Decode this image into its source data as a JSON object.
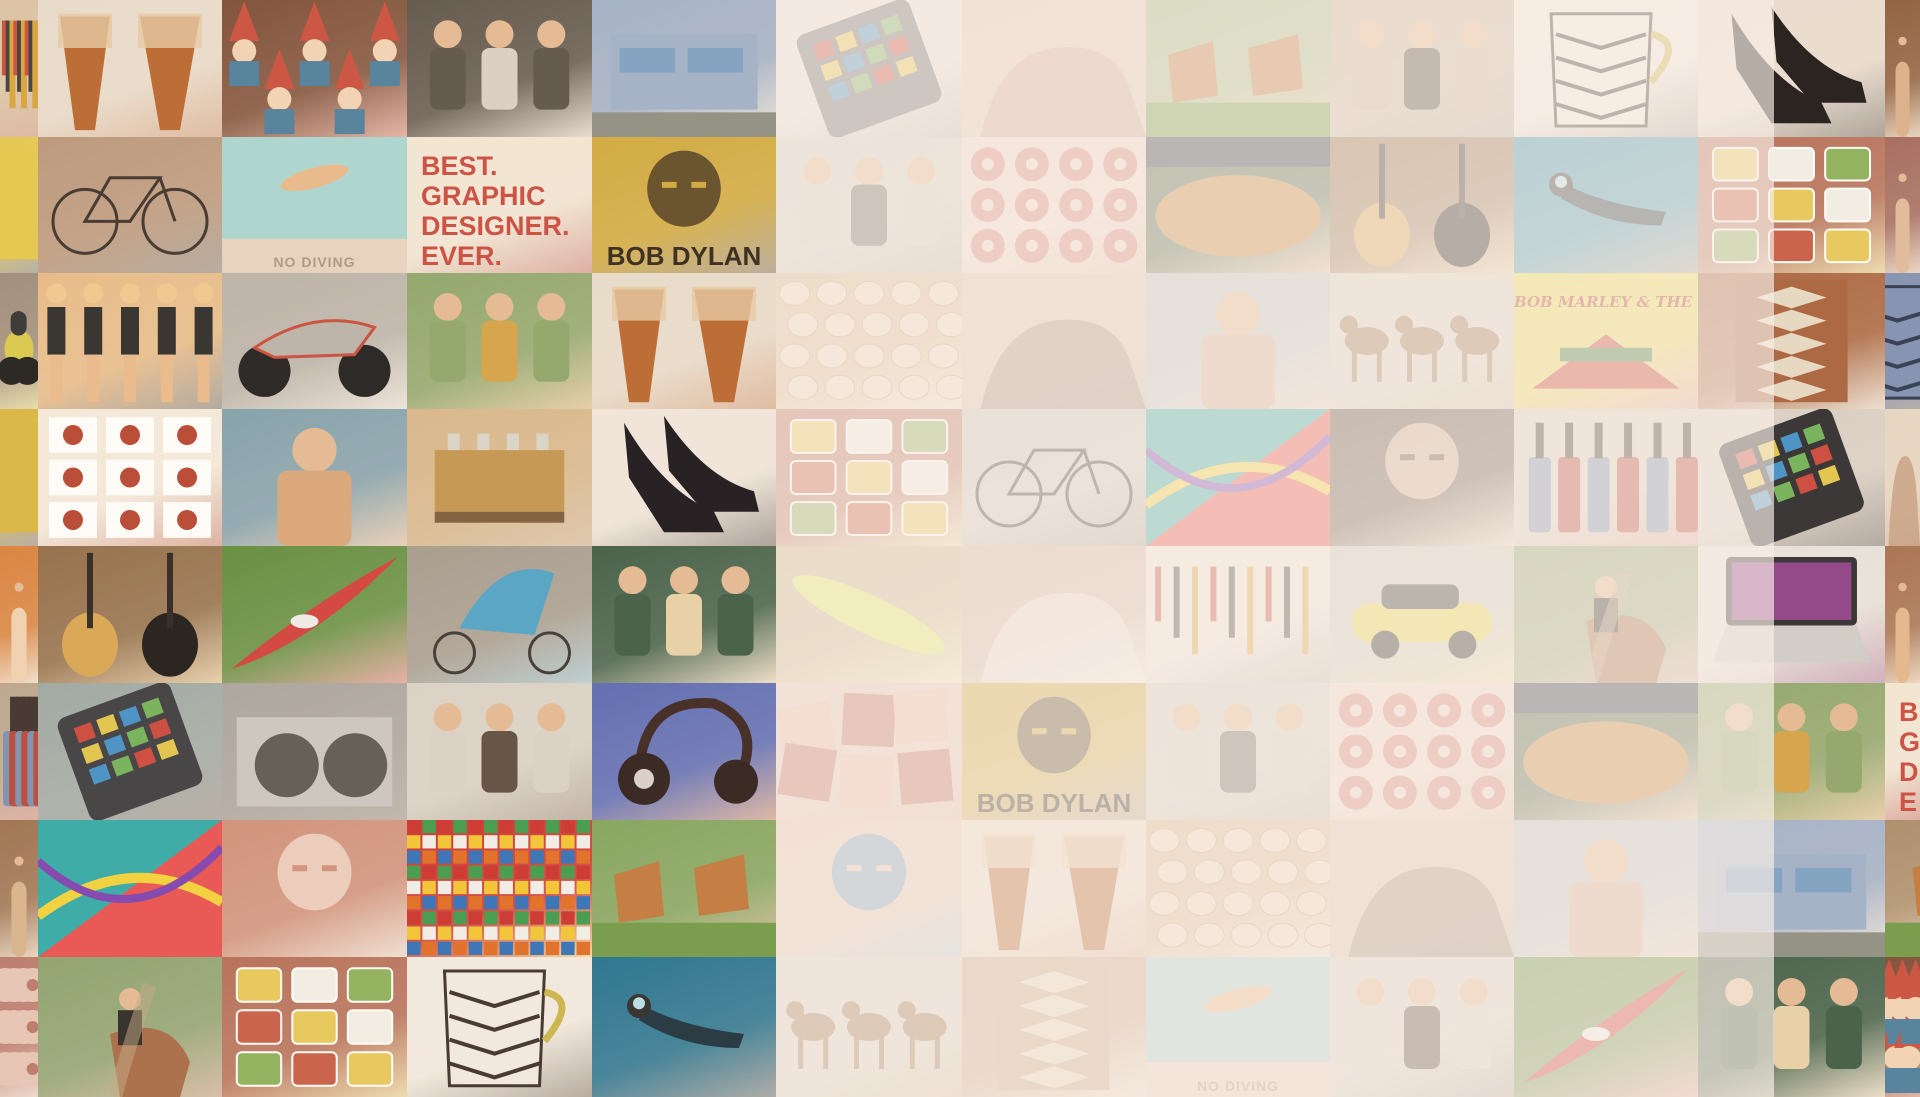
{
  "colors": {
    "veil": "#f8f0ec",
    "background": "#efe6dc"
  },
  "tiles": [
    {
      "name": "tool-rack-photo",
      "icon": "tools",
      "colors": [
        "#d9c3a3",
        "#b55a3c"
      ]
    },
    {
      "name": "djembe-drums-photo",
      "icon": "drums",
      "colors": [
        "#e8dccd",
        "#b8652e"
      ]
    },
    {
      "name": "garden-gnomes-photo",
      "icon": "gnomes",
      "colors": [
        "#7a4a34",
        "#c84d3d"
      ]
    },
    {
      "name": "guitar-band-photo",
      "icon": "people",
      "colors": [
        "#5a5148",
        "#d8d0c6"
      ]
    },
    {
      "name": "modern-house-photo",
      "icon": "house",
      "colors": [
        "#9fb0c9",
        "#e7e4e0"
      ]
    },
    {
      "name": "calculator-photo",
      "icon": "phone",
      "colors": [
        "#e9e2dc",
        "#6a6a70"
      ]
    },
    {
      "name": "hand-closeup-photo",
      "icon": "hand",
      "colors": [
        "#e3c4b8",
        "#c79a8b"
      ]
    },
    {
      "name": "lawn-chairs-photo",
      "icon": "chairs",
      "colors": [
        "#9eb77f",
        "#c0773c"
      ]
    },
    {
      "name": "street-group-photo",
      "icon": "people",
      "colors": [
        "#c7b39e",
        "#4d4136"
      ]
    },
    {
      "name": "patterned-mug-photo",
      "icon": "mug",
      "colors": [
        "#f1ebe3",
        "#3a2e2b"
      ]
    },
    {
      "name": "black-heels-photo",
      "icon": "heels",
      "colors": [
        "#e8ddd1",
        "#1a1516"
      ]
    },
    {
      "name": "portrait-photo",
      "icon": "person",
      "colors": [
        "#8a5b3b",
        "#d9b08a"
      ]
    },
    {
      "name": "yellow-sign-photo",
      "icon": "sign",
      "colors": [
        "#e3c74b",
        "#3b3b3b"
      ]
    },
    {
      "name": "vintage-bicycle-photo",
      "icon": "bike",
      "colors": [
        "#b8957a",
        "#3a2f2a"
      ]
    },
    {
      "name": "pool-diver-photo",
      "icon": "pool",
      "colors": [
        "#a9d6d2",
        "#e6d4c0"
      ],
      "caption": "NO DIVING",
      "captionClass": "tiny",
      "captionColor": "#a89684"
    },
    {
      "name": "graphic-designer-poster",
      "icon": "none",
      "colors": [
        "#f1e7d6",
        "#b23c33"
      ],
      "caption": "BEST.\nGRAPHIC\nDESIGNER.\nEVER.",
      "captionClass": "txt",
      "captionColor": "#c8483d"
    },
    {
      "name": "bob-dylan-poster",
      "icon": "face",
      "colors": [
        "#cfa83a",
        "#4a3820"
      ],
      "caption": "BOB DYLAN",
      "captionColor": "#2f2418"
    },
    {
      "name": "food-scene-photo",
      "icon": "people",
      "colors": [
        "#cfcac2",
        "#6a6a5f"
      ]
    },
    {
      "name": "donut-grid-photo",
      "icon": "donuts",
      "colors": [
        "#f2d9cf",
        "#d5837a"
      ]
    },
    {
      "name": "baseball-stadium-photo",
      "icon": "stadium",
      "colors": [
        "#3f5a3e",
        "#c8853f"
      ]
    },
    {
      "name": "acoustic-guitars-photo",
      "icon": "guitars",
      "colors": [
        "#8f6a46",
        "#d6a552"
      ]
    },
    {
      "name": "scuba-diver-photo",
      "icon": "diver",
      "colors": [
        "#2e8fae",
        "#1b2f3c"
      ]
    },
    {
      "name": "takeout-meals-photo",
      "icon": "meals",
      "colors": [
        "#b36b55",
        "#e6c85a"
      ]
    },
    {
      "name": "partial-portrait-photo",
      "icon": "person",
      "colors": [
        "#a0675c",
        "#e0b99c"
      ]
    },
    {
      "name": "car-partial-photo",
      "icon": "car",
      "colors": [
        "#9b8a7a",
        "#d7c94a"
      ]
    },
    {
      "name": "barbie-dolls-photo",
      "icon": "dolls",
      "colors": [
        "#e7ba87",
        "#2a2a2a"
      ]
    },
    {
      "name": "motorcycle-photo",
      "icon": "motorcycle",
      "colors": [
        "#b8b2aa",
        "#e5e2df"
      ]
    },
    {
      "name": "tie-dye-friends-photo",
      "icon": "people",
      "colors": [
        "#8ca56a",
        "#d3a146"
      ]
    },
    {
      "name": "djembe-drums-photo",
      "icon": "drums",
      "colors": [
        "#e8dccd",
        "#b8652e"
      ]
    },
    {
      "name": "eggs-photo",
      "icon": "eggs",
      "colors": [
        "#d8b894",
        "#f0dcc4"
      ]
    },
    {
      "name": "hand-pencils-photo",
      "icon": "hand",
      "colors": [
        "#dcc0b3",
        "#8b6f64"
      ]
    },
    {
      "name": "lake-fisher-photo",
      "icon": "person",
      "colors": [
        "#b9c1c7",
        "#d8b29a"
      ]
    },
    {
      "name": "dogs-photo",
      "icon": "dogs",
      "colors": [
        "#d7d1c6",
        "#a07655"
      ]
    },
    {
      "name": "reggae-poster",
      "icon": "poster",
      "colors": [
        "#efdc4e",
        "#c93c2e"
      ],
      "caption": "BOB MARLEY & THE WAILERS",
      "captionClass": "reggae",
      "captionColor": "#b53a2c"
    },
    {
      "name": "woven-rug-photo",
      "icon": "rug",
      "colors": [
        "#a6603c",
        "#e5d8c4"
      ]
    },
    {
      "name": "blue-object-photo",
      "icon": "mug",
      "colors": [
        "#7d8fb3",
        "#2c3650"
      ]
    },
    {
      "name": "yellow-letters-photo",
      "icon": "sign",
      "colors": [
        "#d7b53f",
        "#3a3a3a"
      ]
    },
    {
      "name": "snack-plates-photo",
      "icon": "plates",
      "colors": [
        "#f3eadd",
        "#b5432f"
      ]
    },
    {
      "name": "fisher-woman-photo",
      "icon": "person",
      "colors": [
        "#7f9fad",
        "#d9a57a"
      ]
    },
    {
      "name": "espresso-machine-photo",
      "icon": "espresso",
      "colors": [
        "#d6b68b",
        "#b88a56"
      ]
    },
    {
      "name": "louboutin-heels-photo",
      "icon": "heels",
      "colors": [
        "#efe7dd",
        "#17131a"
      ]
    },
    {
      "name": "takeout-meals-photo",
      "icon": "meals",
      "colors": [
        "#b36b55",
        "#e6c85a"
      ]
    },
    {
      "name": "vintage-bicycle-photo",
      "icon": "bike",
      "colors": [
        "#c8c4be",
        "#3a2f2a"
      ]
    },
    {
      "name": "abstract-art-photo",
      "icon": "abstract",
      "colors": [
        "#e84f4f",
        "#2fa9a8"
      ]
    },
    {
      "name": "glasses-man-photo",
      "icon": "face",
      "colors": [
        "#5b4a41",
        "#e0bfa3"
      ]
    },
    {
      "name": "hot-sauce-bottles-photo",
      "icon": "bottles",
      "colors": [
        "#d9cfc5",
        "#b64438"
      ]
    },
    {
      "name": "calculator-hand-photo",
      "icon": "phone",
      "colors": [
        "#d9cfc6",
        "#2b2b2e"
      ]
    },
    {
      "name": "writing-hand-photo",
      "icon": "hand",
      "colors": [
        "#e5d6c3",
        "#b98a6a"
      ]
    },
    {
      "name": "hat-woman-photo",
      "icon": "person",
      "colors": [
        "#d87f3a",
        "#f0d2b1"
      ]
    },
    {
      "name": "acoustic-guitars-photo",
      "icon": "guitars",
      "colors": [
        "#8f6a46",
        "#d6a552"
      ]
    },
    {
      "name": "red-kayak-photo",
      "icon": "kayak",
      "colors": [
        "#5d8b3b",
        "#d23d3b"
      ]
    },
    {
      "name": "bike-trailer-photo",
      "icon": "trailer",
      "colors": [
        "#a39a8e",
        "#4ea2c8"
      ]
    },
    {
      "name": "chalkboard-students-photo",
      "icon": "people",
      "colors": [
        "#3c5a44",
        "#e7d1a8"
      ]
    },
    {
      "name": "surfboard-photo",
      "icon": "surfboard",
      "colors": [
        "#c9b48a",
        "#e1eb6a"
      ]
    },
    {
      "name": "pearl-bracelet-photo",
      "icon": "hand",
      "colors": [
        "#cfb3a6",
        "#f4efe8"
      ]
    },
    {
      "name": "tool-wall-photo",
      "icon": "tools",
      "colors": [
        "#efe6de",
        "#7c6a5d"
      ]
    },
    {
      "name": "yellow-mini-photo",
      "icon": "car",
      "colors": [
        "#cbc7c2",
        "#e6d94a"
      ]
    },
    {
      "name": "horse-rider-photo",
      "icon": "horse",
      "colors": [
        "#8aa06e",
        "#a56a47"
      ]
    },
    {
      "name": "laptop-photo",
      "icon": "laptop",
      "colors": [
        "#e6e2dd",
        "#8b3d86"
      ]
    },
    {
      "name": "tie-dye-partial-photo",
      "icon": "person",
      "colors": [
        "#a56e4f",
        "#e3b68c"
      ]
    },
    {
      "name": "hot-sauce-bottles-photo",
      "icon": "bottles",
      "colors": [
        "#b8a48d",
        "#b64438"
      ]
    },
    {
      "name": "calculator-photo",
      "icon": "phone",
      "colors": [
        "#9ba7a4",
        "#3a3a40"
      ]
    },
    {
      "name": "turntables-photo",
      "icon": "turntables",
      "colors": [
        "#a7a39f",
        "#5a5652"
      ]
    },
    {
      "name": "film-crew-photo",
      "icon": "people",
      "colors": [
        "#d8d2c8",
        "#5b4a40"
      ]
    },
    {
      "name": "headphones-photo",
      "icon": "headphones",
      "colors": [
        "#5767b5",
        "#b6593c"
      ]
    },
    {
      "name": "poster-collage-photo",
      "icon": "collage",
      "colors": [
        "#e3c3b8",
        "#c26e60"
      ]
    },
    {
      "name": "bob-dylan-poster",
      "icon": "face",
      "colors": [
        "#cfa83a",
        "#4a3820"
      ],
      "caption": "BOB DYLAN",
      "captionColor": "#2f2418"
    },
    {
      "name": "food-scene-photo",
      "icon": "people",
      "colors": [
        "#cfcac2",
        "#6a6a5f"
      ]
    },
    {
      "name": "donut-grid-photo",
      "icon": "donuts",
      "colors": [
        "#f2d9cf",
        "#d5837a"
      ]
    },
    {
      "name": "baseball-stadium-photo",
      "icon": "stadium",
      "colors": [
        "#3f5a3e",
        "#c8853f"
      ]
    },
    {
      "name": "tie-dye-friends-photo",
      "icon": "people",
      "colors": [
        "#8ca56a",
        "#d3a146"
      ]
    },
    {
      "name": "graphic-designer-poster",
      "icon": "none",
      "colors": [
        "#f1e7d6",
        "#b23c33"
      ],
      "caption": "B\nG\nD\nE",
      "captionClass": "txt",
      "captionColor": "#c8483d"
    },
    {
      "name": "grandma-photo",
      "icon": "person",
      "colors": [
        "#9a6f4e",
        "#d7b48e"
      ]
    },
    {
      "name": "abstract-art-photo",
      "icon": "abstract",
      "colors": [
        "#e84f4f",
        "#2fa9a8"
      ]
    },
    {
      "name": "face-massage-photo",
      "icon": "face",
      "colors": [
        "#cf8f7a",
        "#f0d5c8"
      ]
    },
    {
      "name": "lego-bricks-photo",
      "icon": "lego",
      "colors": [
        "#c9302c",
        "#f2c531"
      ]
    },
    {
      "name": "lawn-chairs-photo",
      "icon": "chairs",
      "colors": [
        "#7fa35c",
        "#c0773c"
      ]
    },
    {
      "name": "makeup-eye-photo",
      "icon": "face",
      "colors": [
        "#e5c4b5",
        "#6b9bc4"
      ]
    },
    {
      "name": "djembe-drums-photo",
      "icon": "drums",
      "colors": [
        "#e8dccd",
        "#b8652e"
      ]
    },
    {
      "name": "eggs-photo",
      "icon": "eggs",
      "colors": [
        "#d8b894",
        "#f0dcc4"
      ]
    },
    {
      "name": "hand-pencils-photo",
      "icon": "hand",
      "colors": [
        "#dcc0b3",
        "#8b6f64"
      ]
    },
    {
      "name": "fisher-woman-photo",
      "icon": "person",
      "colors": [
        "#b9c1c7",
        "#d8b29a"
      ]
    },
    {
      "name": "modern-house-photo",
      "icon": "house",
      "colors": [
        "#9fb0c9",
        "#e7e4e0"
      ]
    },
    {
      "name": "lounge-chair-photo",
      "icon": "chairs",
      "colors": [
        "#a88b6a",
        "#c0773c"
      ]
    },
    {
      "name": "donut-sign-photo",
      "icon": "donuts",
      "colors": [
        "#b8776a",
        "#e6c5b8"
      ]
    },
    {
      "name": "horse-rider-photo",
      "icon": "horse",
      "colors": [
        "#8aa06e",
        "#a56a47"
      ]
    },
    {
      "name": "takeout-meals-photo",
      "icon": "meals",
      "colors": [
        "#b36b55",
        "#e6c85a"
      ]
    },
    {
      "name": "patterned-mug-photo",
      "icon": "mug",
      "colors": [
        "#f1ebe3",
        "#3a2e2b"
      ]
    },
    {
      "name": "scuba-diver-photo",
      "icon": "diver",
      "colors": [
        "#1f6f8f",
        "#1b2f3c"
      ]
    },
    {
      "name": "dogs-photo",
      "icon": "dogs",
      "colors": [
        "#d7d1c6",
        "#a07655"
      ]
    },
    {
      "name": "woven-rug-photo",
      "icon": "rug",
      "colors": [
        "#c9a48a",
        "#e5d8c4"
      ]
    },
    {
      "name": "pool-diver-photo",
      "icon": "pool",
      "colors": [
        "#a9d6d2",
        "#e6d4c0"
      ],
      "caption": "NO DIVING",
      "captionClass": "tiny",
      "captionColor": "#a89684"
    },
    {
      "name": "film-crew-photo",
      "icon": "people",
      "colors": [
        "#d8d2c8",
        "#5b4a40"
      ]
    },
    {
      "name": "red-kayak-photo",
      "icon": "kayak",
      "colors": [
        "#5d8b3b",
        "#d23d3b"
      ]
    },
    {
      "name": "chalkboard-students-photo",
      "icon": "people",
      "colors": [
        "#3c5a44",
        "#e7d1a8"
      ]
    },
    {
      "name": "gnome-partial-photo",
      "icon": "gnomes",
      "colors": [
        "#7a4a34",
        "#c84d3d"
      ]
    }
  ]
}
